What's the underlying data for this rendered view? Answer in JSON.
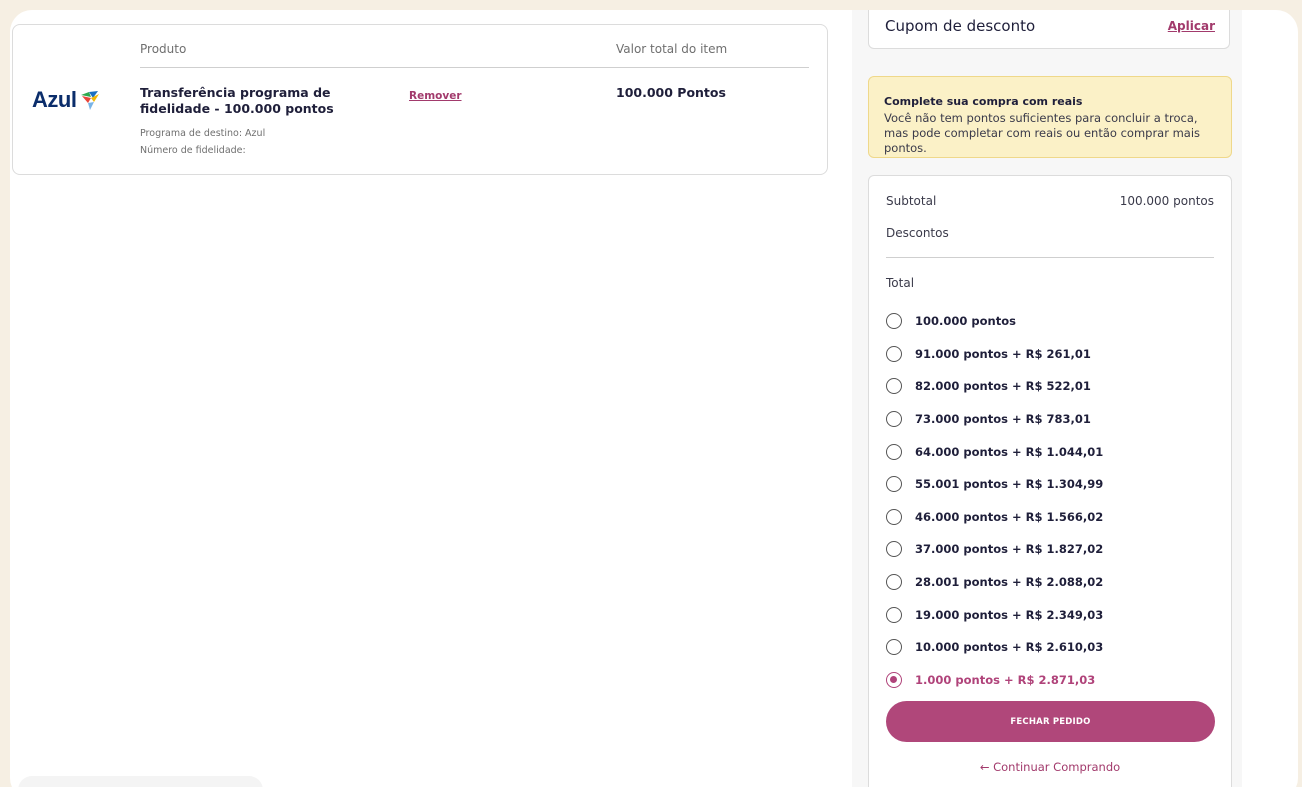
{
  "cart": {
    "col_product": "Produto",
    "col_total": "Valor total do item",
    "logo_text": "Azul",
    "item": {
      "name": "Transferência programa de fidelidade - 100.000 pontos",
      "remove_label": "Remover",
      "total": "100.000 Pontos",
      "destination": "Programa de destino: Azul",
      "loyalty_number": "Número de fidelidade:"
    }
  },
  "coupon": {
    "label": "Cupom de desconto",
    "apply_label": "Aplicar"
  },
  "alert": {
    "title": "Complete sua compra com reais",
    "body": "Você não tem pontos suficientes para concluir a troca, mas pode completar com reais ou então comprar mais pontos."
  },
  "summary": {
    "subtotal_label": "Subtotal",
    "subtotal_value": "100.000 pontos",
    "discounts_label": "Descontos",
    "total_label": "Total",
    "options": [
      "100.000 pontos",
      "91.000 pontos + R$ 261,01",
      "82.000 pontos + R$ 522,01",
      "73.000 pontos + R$ 783,01",
      "64.000 pontos + R$ 1.044,01",
      "55.001 pontos + R$ 1.304,99",
      "46.000 pontos + R$ 1.566,02",
      "37.000 pontos + R$ 1.827,02",
      "28.001 pontos + R$ 2.088,02",
      "19.000 pontos + R$ 2.349,03",
      "10.000 pontos + R$ 2.610,03",
      "1.000 pontos + R$ 2.871,03"
    ],
    "selected_option": "1.000 pontos + R$ 2.871,03",
    "checkout_label": "FECHAR PEDIDO",
    "continue_label": "← Continuar Comprando"
  },
  "colors": {
    "accent": "#b0477a",
    "link": "#a23a6c",
    "alert_bg": "#fbf1c7",
    "logo_blue": "#0b2d6b"
  }
}
